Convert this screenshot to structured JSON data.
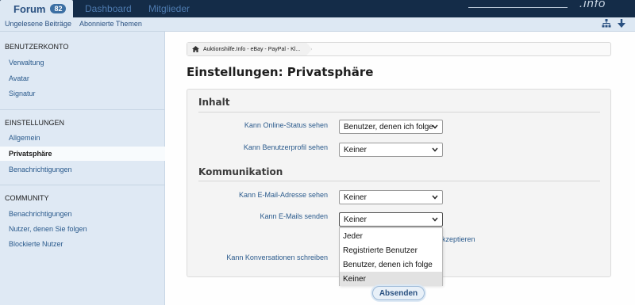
{
  "header": {
    "tabs": [
      {
        "label": "Forum",
        "badge": "82"
      },
      {
        "label": "Dashboard"
      },
      {
        "label": "Mitglieder"
      }
    ],
    "logo_fragment": ".info"
  },
  "subnav": {
    "links": [
      "Ungelesene Beiträge",
      "Abonnierte Themen"
    ],
    "icons": [
      "sitemap-icon",
      "arrow-down-icon"
    ]
  },
  "sidebar": {
    "sections": [
      {
        "title": "BENUTZERKONTO",
        "items": [
          "Verwaltung",
          "Avatar",
          "Signatur"
        ]
      },
      {
        "title": "EINSTELLUNGEN",
        "items": [
          "Allgemein",
          "Privatsphäre",
          "Benachrichtigungen"
        ],
        "active": "Privatsphäre"
      },
      {
        "title": "COMMUNITY",
        "items": [
          "Benachrichtigungen",
          "Nutzer, denen Sie folgen",
          "Blockierte Nutzer"
        ]
      }
    ]
  },
  "breadcrumb": {
    "items": [
      "Auktionshilfe.Info - eBay - PayPal - Kl..."
    ]
  },
  "page_title": "Einstellungen: Privatsphäre",
  "form": {
    "groups": [
      {
        "heading": "Inhalt",
        "fields": [
          {
            "label": "Kann Online-Status sehen",
            "value": "Benutzer, denen ich folge"
          },
          {
            "label": "Kann Benutzerprofil sehen",
            "value": "Keiner"
          }
        ]
      },
      {
        "heading": "Kommunikation",
        "fields": [
          {
            "label": "Kann E-Mail-Adresse sehen",
            "value": "Keiner"
          },
          {
            "label": "Kann E-Mails senden",
            "value": "Keiner"
          },
          {
            "label": "Kann Konversationen schreiben",
            "value": ""
          }
        ]
      }
    ],
    "partial_text": "kzeptieren",
    "dropdown_options": [
      "Jeder",
      "Registrierte Benutzer",
      "Benutzer, denen ich folge",
      "Keiner"
    ],
    "dropdown_selected": "Keiner",
    "submit_label": "Absenden"
  },
  "colors": {
    "header_bg": "#142c48",
    "link": "#2a5a8c",
    "sidebar_bg": "#dfe9f4",
    "badge_bg": "#3b6fa3"
  }
}
